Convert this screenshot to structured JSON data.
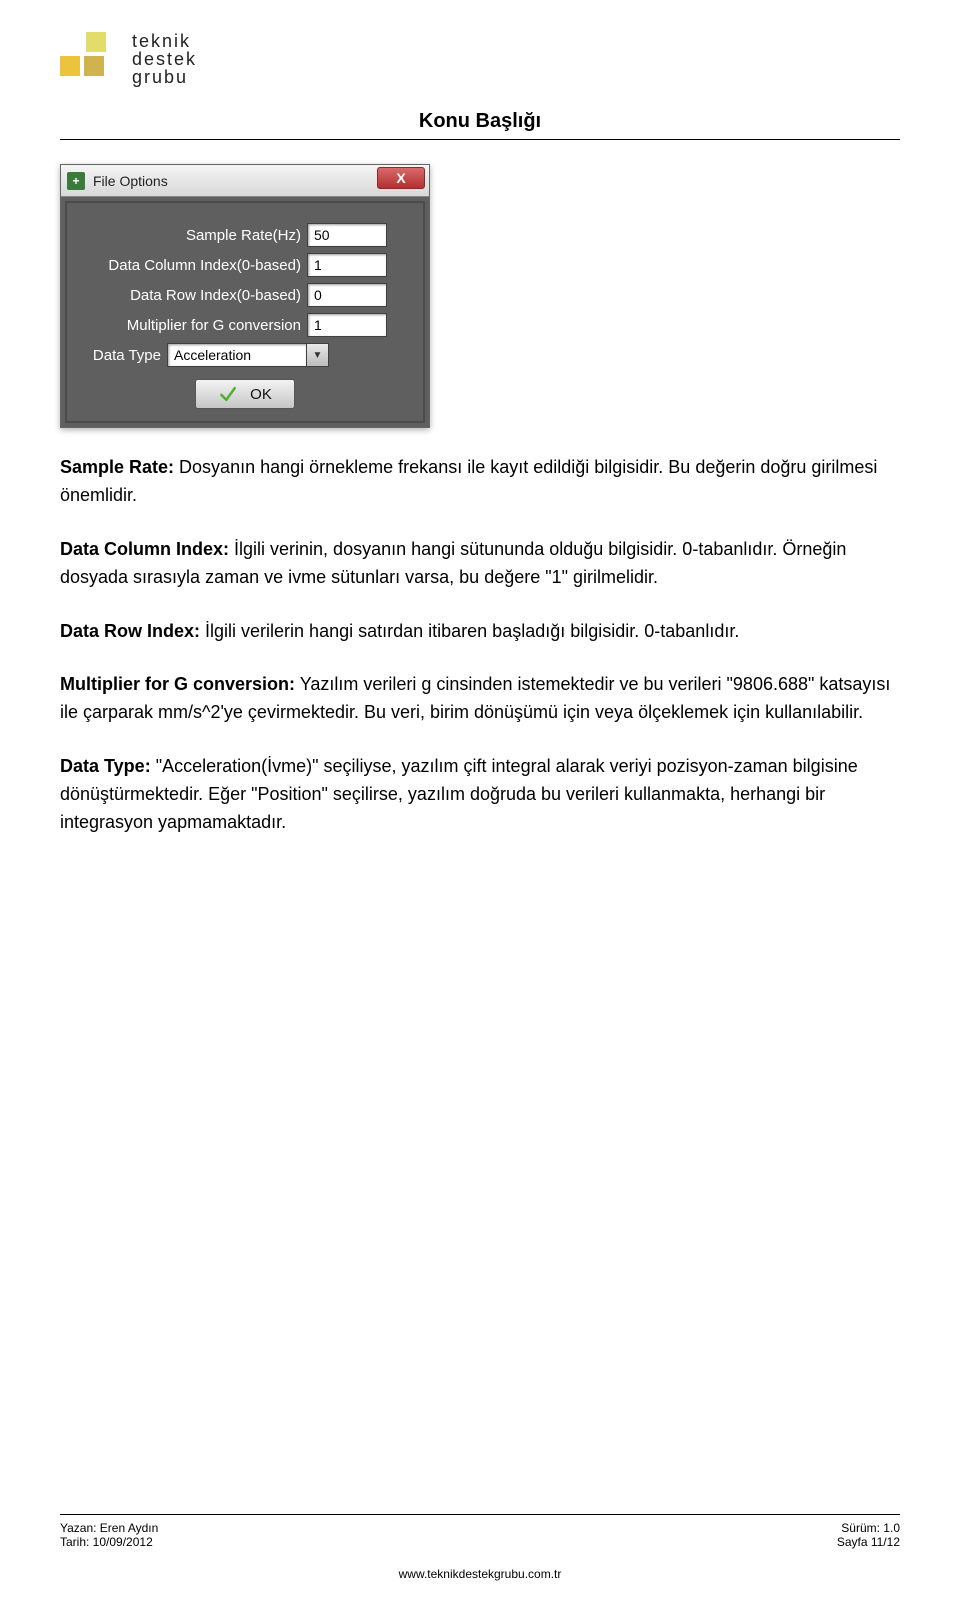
{
  "logo_text": {
    "line1": "teknik",
    "line2": "destek",
    "line3": "grubu"
  },
  "doc_title": "Konu Başlığı",
  "dialog": {
    "title": "File Options",
    "close_label": "X",
    "fields": {
      "sample_rate": {
        "label": "Sample Rate(Hz)",
        "value": "50"
      },
      "data_col": {
        "label": "Data Column Index(0-based)",
        "value": "1"
      },
      "data_row": {
        "label": "Data Row Index(0-based)",
        "value": "0"
      },
      "multiplier": {
        "label": "Multiplier for G conversion",
        "value": "1"
      },
      "data_type": {
        "label": "Data Type",
        "value": "Acceleration"
      }
    },
    "ok_label": "OK"
  },
  "paragraphs": {
    "p1": {
      "bold": "Sample Rate:",
      "text": " Dosyanın hangi örnekleme frekansı ile kayıt edildiği bilgisidir. Bu değerin doğru girilmesi önemlidir."
    },
    "p2": {
      "bold": "Data Column Index:",
      "text": " İlgili verinin, dosyanın hangi sütununda olduğu bilgisidir. 0-tabanlıdır. Örneğin dosyada sırasıyla zaman ve ivme sütunları varsa, bu değere \"1\" girilmelidir."
    },
    "p3": {
      "bold": "Data Row Index:",
      "text": " İlgili verilerin hangi satırdan itibaren başladığı bilgisidir. 0-tabanlıdır."
    },
    "p4": {
      "bold": "Multiplier for G conversion:",
      "text": " Yazılım verileri g cinsinden istemektedir ve bu verileri \"9806.688\" katsayısı ile çarparak mm/s^2'ye çevirmektedir. Bu veri, birim dönüşümü için veya ölçeklemek için kullanılabilir."
    },
    "p5": {
      "bold": "Data Type:",
      "text": " \"Acceleration(İvme)\" seçiliyse, yazılım çift integral alarak veriyi pozisyon-zaman bilgisine dönüştürmektedir. Eğer \"Position\" seçilirse, yazılım doğruda bu verileri kullanmakta, herhangi bir integrasyon yapmamaktadır."
    }
  },
  "footer": {
    "author_label": "Yazan: Eren Aydın",
    "date_label": "Tarih: 10/09/2012",
    "version_label": "Sürüm: 1.0",
    "page_label": "Sayfa 11/12",
    "url": "www.teknikdestekgrubu.com.tr"
  }
}
